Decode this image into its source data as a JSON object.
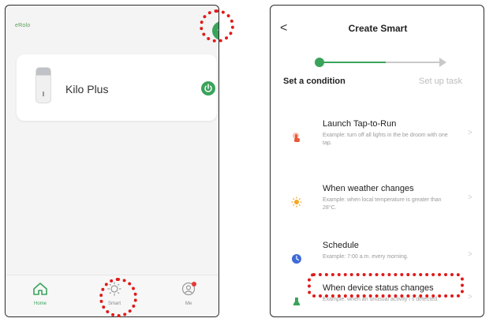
{
  "left": {
    "brand": "eRolo",
    "device": {
      "name": "Kilo Plus"
    },
    "tabs": [
      {
        "label": "Home",
        "icon": "home-icon"
      },
      {
        "label": "Smart",
        "icon": "sun-icon"
      },
      {
        "label": "Me",
        "icon": "user-icon"
      }
    ]
  },
  "right": {
    "header": {
      "back": "<",
      "title": "Create Smart"
    },
    "steps": [
      {
        "label": "Set a condition"
      },
      {
        "label": "Set up task"
      }
    ],
    "options": [
      {
        "title": "Launch Tap-to-Run",
        "desc": "Example: turn off all lights in the be droom with one tap.",
        "icon": "tap-icon"
      },
      {
        "title": "When weather changes",
        "desc": "Example: when local temperature is greater than 28°C.",
        "icon": "sun-icon"
      },
      {
        "title": "Schedule",
        "desc": "Example: 7:00 a.m. every morning.",
        "icon": "clock-icon"
      },
      {
        "title": "When device status changes",
        "desc": "Example: when an unusual activity i s detected.",
        "icon": "device-icon"
      }
    ]
  },
  "colors": {
    "accent": "#3aa35b",
    "highlight": "#e01a1a"
  }
}
